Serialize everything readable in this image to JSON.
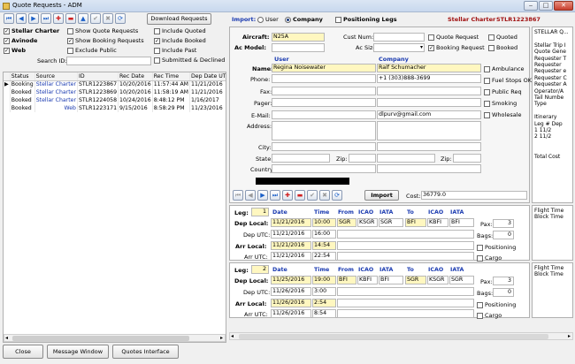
{
  "window": {
    "title": "Quote Requests - ADM"
  },
  "toolbar": {
    "download_label": "Download Requests"
  },
  "filters": {
    "sources": [
      {
        "label": "Stellar Charter",
        "checked": true
      },
      {
        "label": "Avinode",
        "checked": true
      },
      {
        "label": "Web",
        "checked": true
      }
    ],
    "middle": [
      {
        "label": "Show Quote Requests",
        "checked": false
      },
      {
        "label": "Show Booking Requests",
        "checked": true
      },
      {
        "label": "Exclude Public",
        "checked": false
      }
    ],
    "right": [
      {
        "label": "Include Quoted",
        "checked": false
      },
      {
        "label": "Include Booked",
        "checked": true
      },
      {
        "label": "Include Past",
        "checked": false
      },
      {
        "label": "Submitted & Declined",
        "checked": false
      }
    ],
    "search_label": "Search ID:",
    "search_value": ""
  },
  "table": {
    "columns": [
      "Status",
      "Source",
      "ID",
      "Rec Date",
      "Rec Time",
      "Dep Date UTC",
      "De"
    ],
    "rows": [
      [
        "Booking",
        "Stellar Charter",
        "STLR1223867",
        "10/20/2016",
        "11:57:44 AM",
        "11/21/2016",
        "4:0"
      ],
      [
        "Booked",
        "Stellar Charter",
        "STLR1223869",
        "10/20/2016",
        "11:58:19 AM",
        "11/21/2016",
        "2:3"
      ],
      [
        "Booked",
        "Stellar Charter",
        "STLR1224058",
        "10/24/2016",
        "8:48:12 PM",
        "1/16/2017",
        "5:0"
      ],
      [
        "Booked",
        "Web",
        "STLR1223171",
        "9/15/2016",
        "8:58:29 PM",
        "11/23/2016",
        "3:3"
      ]
    ]
  },
  "import_bar": {
    "label": "Import:",
    "opt_user": "User",
    "opt_company": "Company",
    "positioning": "Positioning Legs",
    "charter_name": "Stellar Charter",
    "charter_id": "STLR1223867"
  },
  "aircraft": {
    "label": "Aircraft:",
    "value": "N25A",
    "model_label": "Ac Model:",
    "model_value": "",
    "custnum_label": "Cust Num:",
    "custnum_value": "",
    "acsize_label": "Ac Size:",
    "acsize_value": ""
  },
  "req": {
    "quote_request": "Quote Request",
    "booking_request": "Booking Request",
    "quoted": "Quoted",
    "booked": "Booked"
  },
  "contact": {
    "user_header": "User",
    "company_header": "Company",
    "name_label": "Name:",
    "name_user": "Regina Noisewater",
    "name_company": "Ralf Schumacher",
    "phone_label": "Phone:",
    "phone_company": "+1 (303)888-3699",
    "fax_label": "Fax:",
    "pager_label": "Pager:",
    "email_label": "E-Mail:",
    "email_company": "dlpurv@gmail.com",
    "address_label": "Address:",
    "city_label": "City:",
    "state_label": "State:",
    "zip_label": "Zip:",
    "country_label": "Country:"
  },
  "services": [
    "Ambulance",
    "Fuel Stops OK",
    "Public Req",
    "Smoking",
    "Wholesale"
  ],
  "cost": {
    "import_label": "Import",
    "cost_label": "Cost:",
    "cost_value": "36779.0"
  },
  "legs": [
    {
      "label": "Leg:",
      "num": "1",
      "date_h": "Date",
      "time_h": "Time",
      "from_h": "From",
      "icao_h": "ICAO",
      "iata_h": "IATA",
      "to_h": "To",
      "dep_local_label": "Dep Local:",
      "dep_local_date": "11/21/2016",
      "dep_local_time": "10:00",
      "from": "SGR",
      "from_icao": "KSGR",
      "from_iata": "SGR",
      "to": "BFI",
      "to_icao": "KBFI",
      "to_iata": "BFI",
      "dep_utc_label": "Dep UTC:",
      "dep_utc_date": "11/21/2016",
      "dep_utc_time": "16:00",
      "arr_local_label": "Arr Local:",
      "arr_local_date": "11/21/2016",
      "arr_local_time": "14:54",
      "arr_utc_label": "Arr UTC:",
      "arr_utc_date": "11/21/2016",
      "arr_utc_time": "22:54",
      "pax_label": "Pax:",
      "pax": "3",
      "bags_label": "Bags:",
      "bags": "0",
      "positioning": "Positioning",
      "cargo": "Cargo"
    },
    {
      "label": "Leg:",
      "num": "2",
      "date_h": "Date",
      "time_h": "Time",
      "from_h": "From",
      "icao_h": "ICAO",
      "iata_h": "IATA",
      "to_h": "To",
      "dep_local_label": "Dep Local:",
      "dep_local_date": "11/25/2016",
      "dep_local_time": "19:00",
      "from": "BFI",
      "from_icao": "KBFI",
      "from_iata": "BFI",
      "to": "SGR",
      "to_icao": "KSGR",
      "to_iata": "SGR",
      "dep_utc_label": "Dep UTC:",
      "dep_utc_date": "11/26/2016",
      "dep_utc_time": "3:00",
      "arr_local_label": "Arr Local:",
      "arr_local_date": "11/26/2016",
      "arr_local_time": "2:54",
      "arr_utc_label": "Arr UTC:",
      "arr_utc_date": "11/26/2016",
      "arr_utc_time": "8:54",
      "pax_label": "Pax:",
      "pax": "3",
      "bags_label": "Bags:",
      "bags": "0",
      "positioning": "Positioning",
      "cargo": "Cargo"
    }
  ],
  "summary": {
    "lines": [
      "STELLAR Q...",
      "",
      "Stellar Trip I",
      "Quote Gene",
      "Requester T",
      "Requester",
      "Requester e",
      "Requester C",
      "Requester A",
      "Operator/A",
      "Tail Numbe",
      "Type",
      "",
      "Itinerary",
      "Leg #  Dep",
      "1     11/2",
      "2     11/2",
      "",
      "",
      "Total Cost"
    ]
  },
  "leg_summary": [
    "Flight Time",
    "Block Time"
  ],
  "footer": {
    "close": "Close",
    "message": "Message Window",
    "quotes": "Quotes Interface"
  },
  "colors": {
    "accent": "#1a3ab0",
    "brand_red": "#a01010",
    "highlight": "#fff7c0"
  }
}
